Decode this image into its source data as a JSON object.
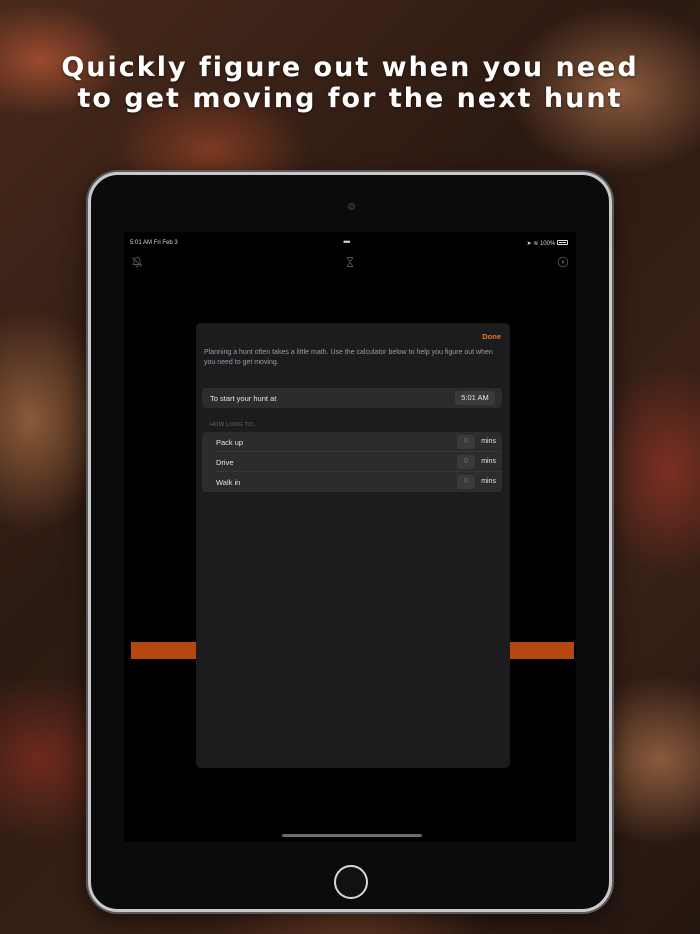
{
  "headline": {
    "line1": "Quickly figure out when you need",
    "line2": "to get moving for the next hunt"
  },
  "status_bar": {
    "time_date": "5:01 AM   Fri Feb 3",
    "battery": "100%"
  },
  "toolbar": {
    "left_icon": "bell-slash-icon",
    "center_icon": "hourglass-icon",
    "right_icon": "play-circle-icon"
  },
  "modal": {
    "done_label": "Done",
    "intro": "Planning a hunt often takes a little math. Use the calculator below to help you figure out when you need to get moving.",
    "start": {
      "label": "To start your hunt at",
      "time": "5:01 AM"
    },
    "section_header": "HOW LONG TO...",
    "rows": [
      {
        "label": "Pack up",
        "value": "0",
        "unit": "mins"
      },
      {
        "label": "Drive",
        "value": "0",
        "unit": "mins"
      },
      {
        "label": "Walk in",
        "value": "0",
        "unit": "mins"
      }
    ]
  },
  "colors": {
    "accent": "#e8741f",
    "bar": "#b5470f",
    "modal_bg": "#1c1c1e",
    "cell_bg": "#2c2c2e"
  }
}
